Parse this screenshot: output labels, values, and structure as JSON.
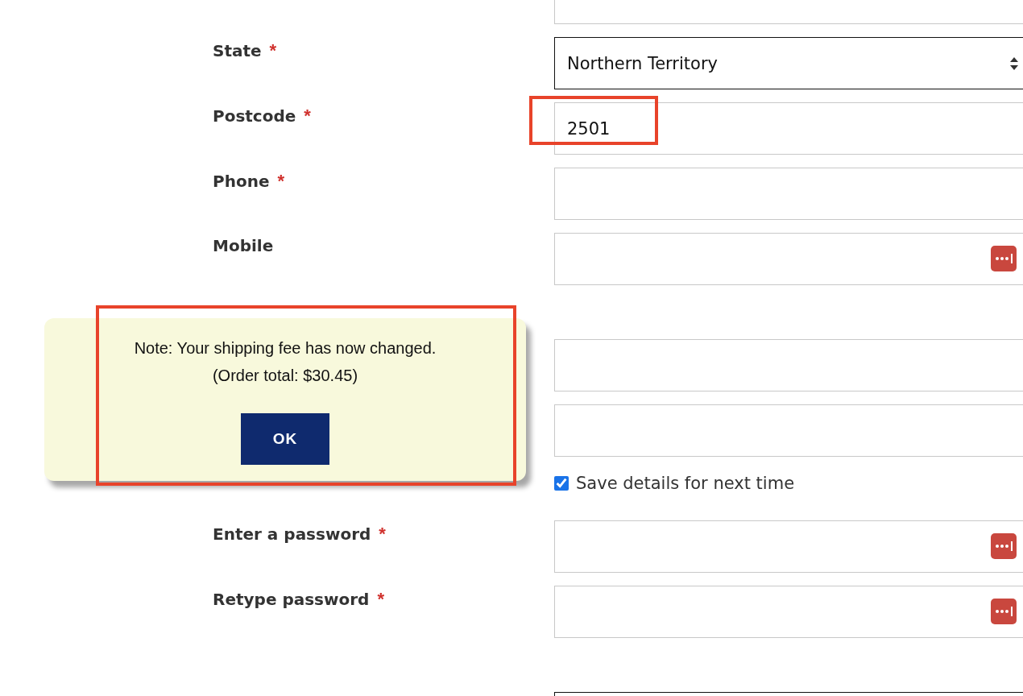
{
  "sections": [
    {
      "fields": [
        {
          "kind": "input"
        },
        {
          "kind": "select",
          "label": "State",
          "required_mark": "*",
          "value": "Northern Territory"
        },
        {
          "kind": "input",
          "label": "Postcode",
          "required_mark": "*",
          "value": "2501",
          "highlighted": true
        },
        {
          "kind": "input",
          "label": "Phone",
          "required_mark": "*"
        },
        {
          "kind": "input",
          "label": "Mobile",
          "password_manager": true
        }
      ]
    },
    {
      "fields": [
        {
          "kind": "input"
        },
        {
          "kind": "input"
        },
        {
          "kind": "checkbox",
          "label": "Save details for next time",
          "checked": true
        },
        {
          "kind": "input",
          "label": "Enter a password",
          "required_mark": "*",
          "password_manager": true
        },
        {
          "kind": "input",
          "label": "Retype password",
          "required_mark": "*",
          "password_manager": true
        }
      ]
    },
    {
      "fields": [
        {
          "kind": "select"
        }
      ]
    }
  ],
  "dialog": {
    "message": "Note: Your shipping fee has now changed.",
    "detail": "(Order total: $30.45)",
    "button": "OK",
    "highlighted": true
  }
}
